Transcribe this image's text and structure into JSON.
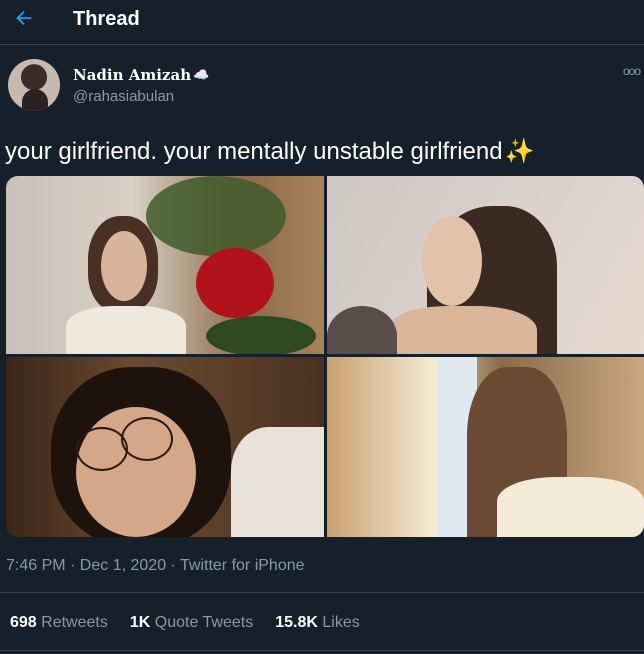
{
  "header": {
    "title": "Thread",
    "back_icon": "arrow-left-icon",
    "accent": "#1da1f2"
  },
  "author": {
    "name": "Nadin Amizah",
    "name_emoji": "☁️",
    "handle": "@rahasiabulan"
  },
  "more_icon": "more-dots-icon",
  "tweet": {
    "text": "your girlfriend. your mentally unstable girlfriend",
    "emoji": "✨"
  },
  "meta": {
    "timestamp": "7:46 PM · Dec 1, 2020 · Twitter for iPhone"
  },
  "stats": {
    "retweets_count": "698",
    "retweets_label": "Retweets",
    "quotes_count": "1K",
    "quotes_label": "Quote Tweets",
    "likes_count": "15.8K",
    "likes_label": "Likes"
  },
  "colors": {
    "background": "#15202b",
    "muted": "#8899a6",
    "divider": "#38444d"
  }
}
